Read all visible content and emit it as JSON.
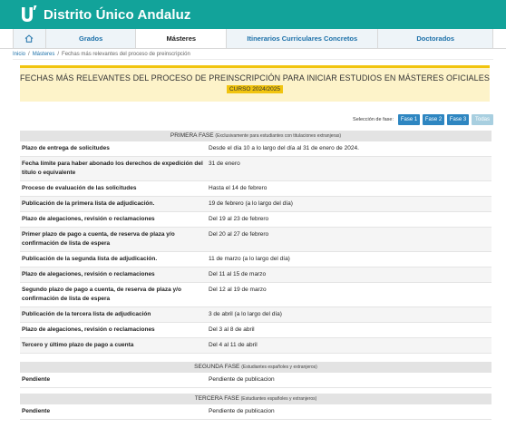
{
  "header": {
    "brand": "Distrito Único Andaluz"
  },
  "nav": {
    "home_icon": "home-icon",
    "items": [
      "Grados",
      "Másteres",
      "Itinerarios Curriculares Concretos",
      "Doctorados"
    ]
  },
  "breadcrumb": {
    "home": "Inicio",
    "section": "Másteres",
    "current": "Fechas más relevantes del proceso de preinscripción"
  },
  "banner": {
    "title": "FECHAS MÁS RELEVANTES DEL PROCESO DE PREINSCRIPCIÓN PARA INICIAR ESTUDIOS EN MÁSTERES OFICIALES",
    "course": "CURSO 2024/2025"
  },
  "phase_selector": {
    "label": "Selección de fase:",
    "buttons": [
      "Fase 1",
      "Fase 2",
      "Fase 3",
      "Todas"
    ]
  },
  "phases": [
    {
      "name": "PRIMERA FASE",
      "note": "(Exclusivamente para estudiantes con titulaciones extranjeras)",
      "rows": [
        {
          "label": "Plazo de entrega de solicitudes",
          "value": "Desde el día 10 a lo largo del día al 31 de enero de 2024."
        },
        {
          "label": "Fecha límite para haber abonado los derechos de expedición del título o equivalente",
          "value": "31 de enero"
        },
        {
          "label": "Proceso de evaluación de las solicitudes",
          "value": "Hasta el 14 de febrero"
        },
        {
          "label": "Publicación de la primera lista de adjudicación.",
          "value": "19 de febrero (a lo largo del día)"
        },
        {
          "label": "Plazo de alegaciones, revisión o reclamaciones",
          "value": "Del 19 al 23 de febrero"
        },
        {
          "label": "Primer plazo de pago a cuenta, de reserva de plaza y/o confirmación de lista de espera",
          "value": "Del 20 al 27 de febrero"
        },
        {
          "label": "Publicación de la segunda lista de adjudicación.",
          "value": "11 de marzo (a lo largo del día)"
        },
        {
          "label": "Plazo de alegaciones, revisión o reclamaciones",
          "value": "Del 11 al 15 de marzo"
        },
        {
          "label": "Segundo plazo de pago a cuenta, de reserva de plaza y/o confirmación de lista de espera",
          "value": "Del 12 al 19 de marzo"
        },
        {
          "label": "Publicación de la tercera lista de adjudicación",
          "value": "3 de abril (a lo largo del día)"
        },
        {
          "label": "Plazo de alegaciones, revisión o reclamaciones",
          "value": "Del 3 al 8 de abril"
        },
        {
          "label": "Tercero y último plazo de pago a cuenta",
          "value": "Del 4 al 11 de abril"
        }
      ]
    },
    {
      "name": "SEGUNDA FASE",
      "note": "(Estudiantes españoles y extranjeros)",
      "rows": [
        {
          "label": "Pendiente",
          "value": "Pendiente de publicacion"
        }
      ]
    },
    {
      "name": "TERCERA FASE",
      "note": "(Estudiantes españoles y extranjeros)",
      "rows": [
        {
          "label": "Pendiente",
          "value": "Pendiente de publicacion"
        }
      ]
    }
  ],
  "colors": {
    "header": "#12a39a",
    "accent": "#f1c40f",
    "button": "#2e86c1"
  }
}
